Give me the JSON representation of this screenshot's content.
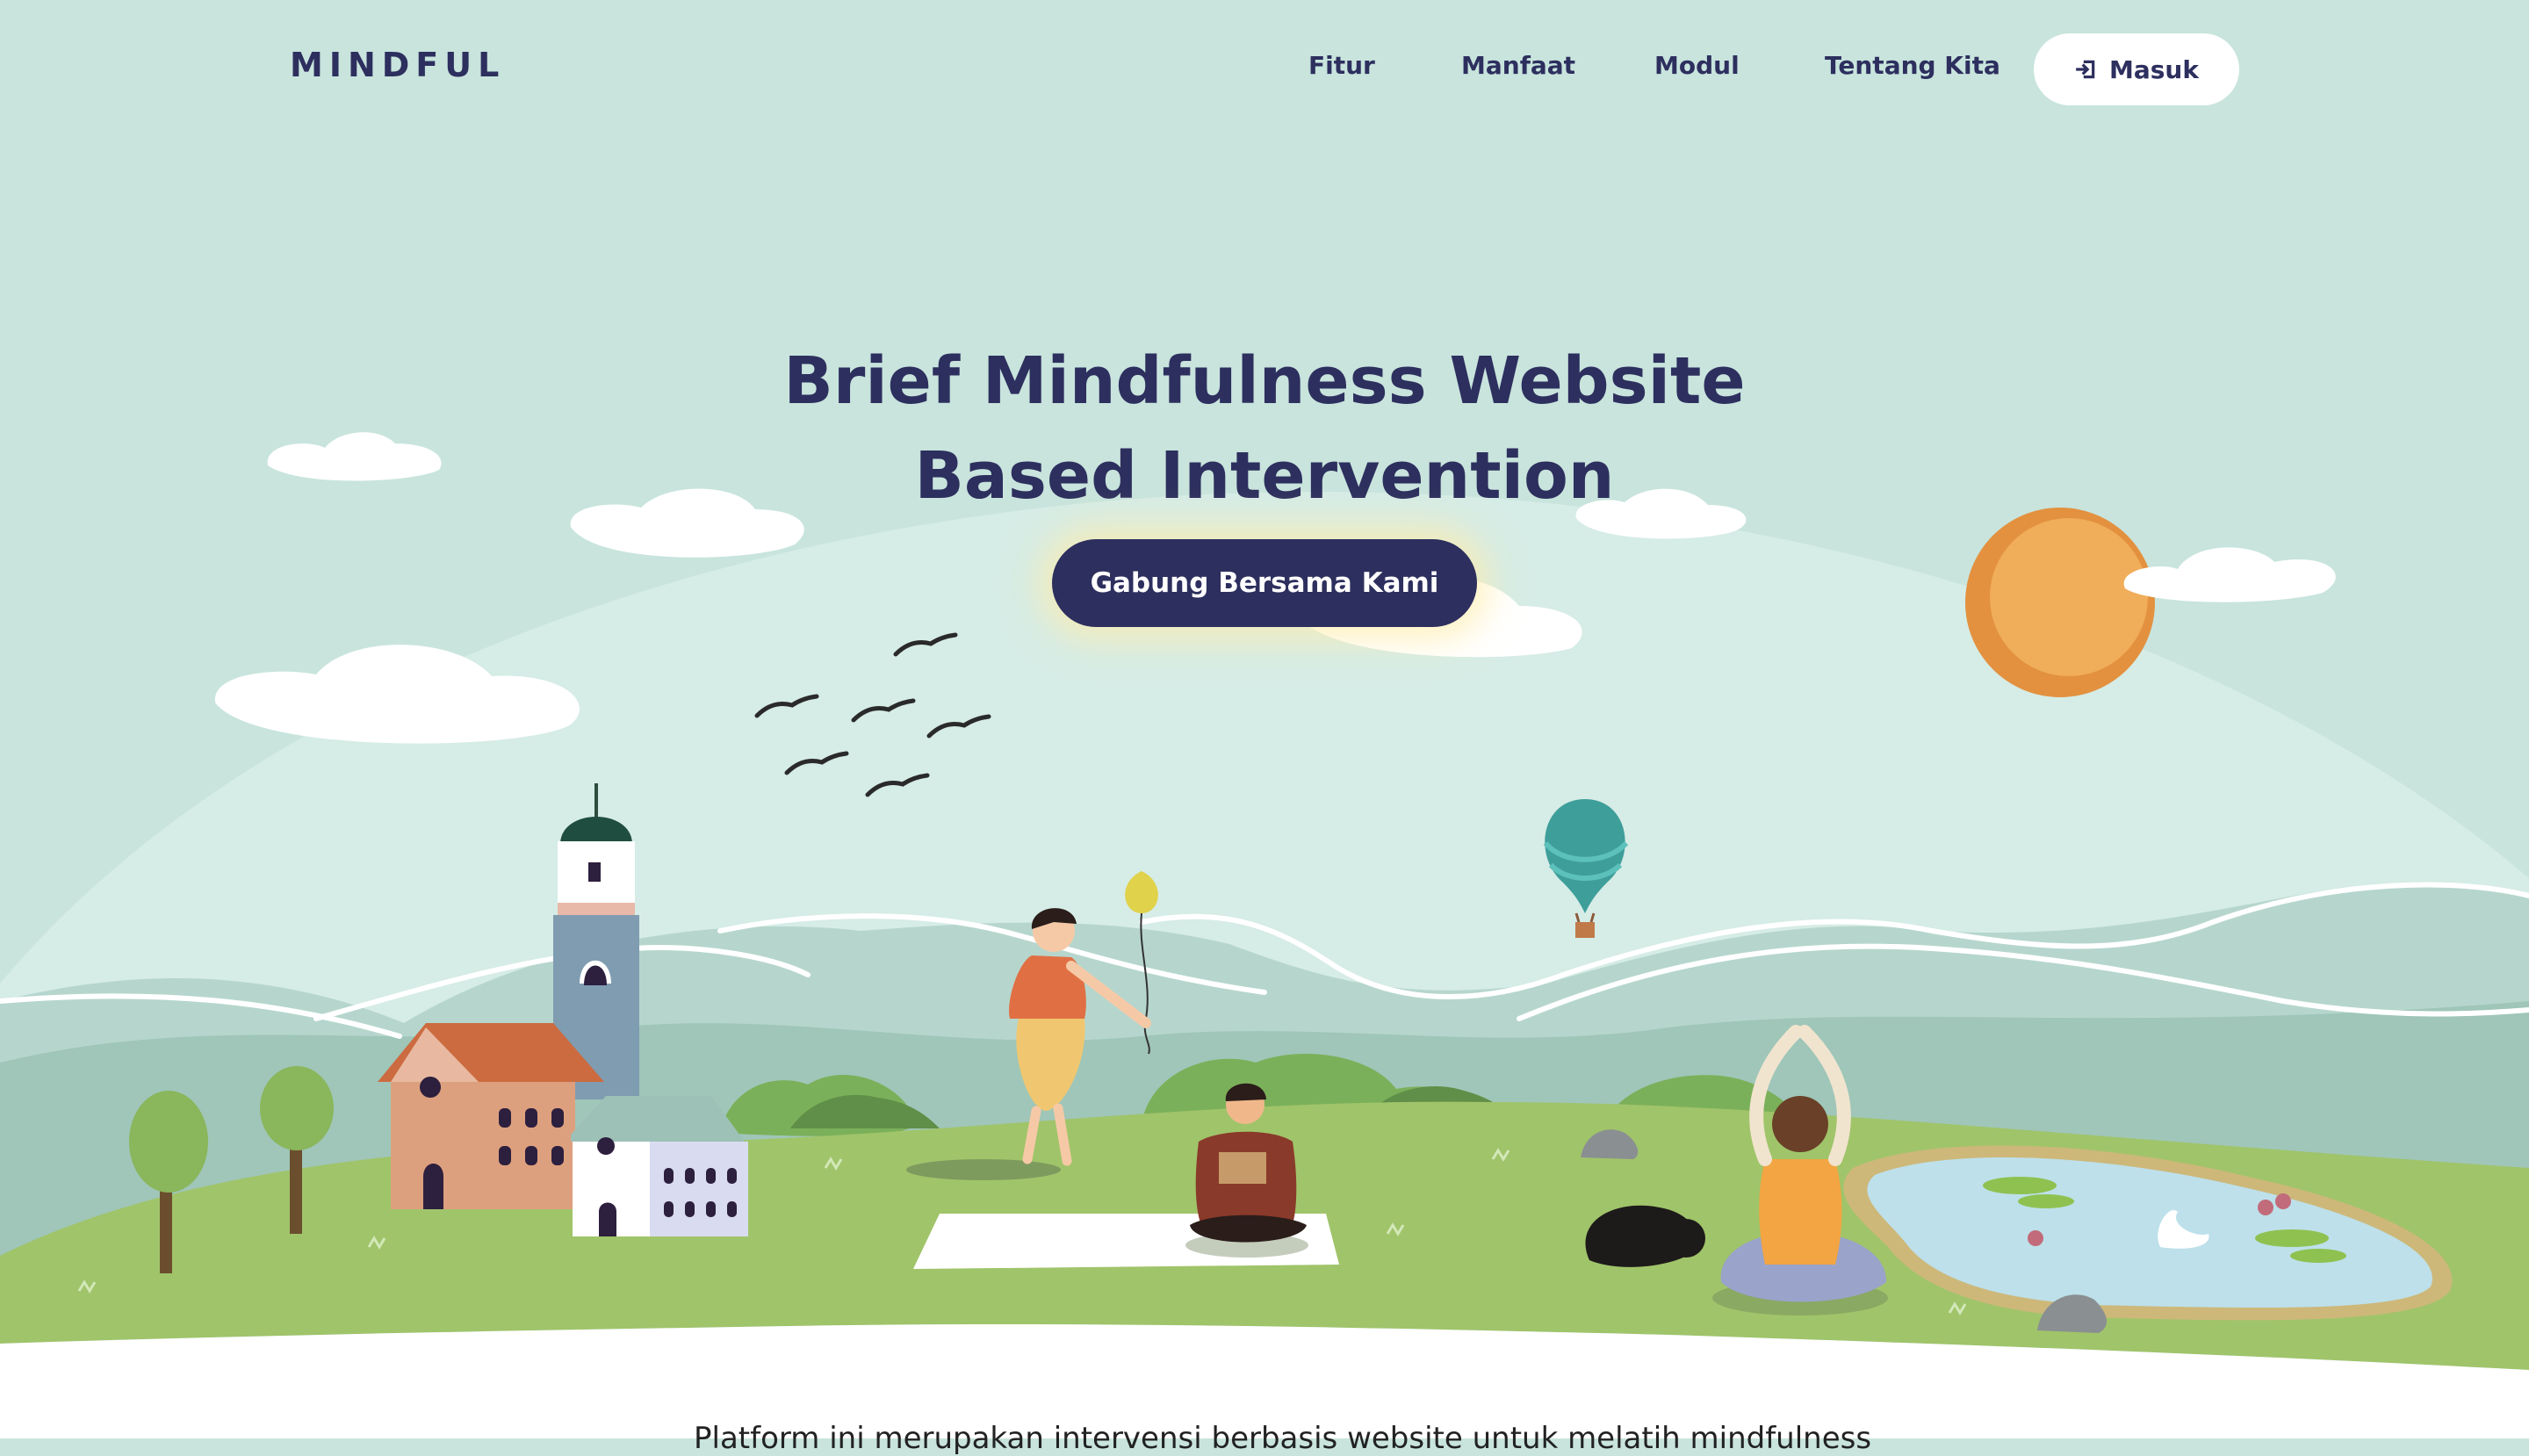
{
  "brand": {
    "logo": "MINDFUL"
  },
  "nav": {
    "links": [
      "Fitur",
      "Manfaat",
      "Modul",
      "Tentang Kita"
    ],
    "login_label": "Masuk"
  },
  "hero": {
    "title_line1": "Brief Mindfulness Website",
    "title_line2": "Based Intervention",
    "cta_label": "Gabung Bersama Kami"
  },
  "below_fold": {
    "intro_text": "Platform ini merupakan intervensi berbasis website untuk melatih mindfulness"
  },
  "colors": {
    "sky": "#c8e4dd",
    "navy": "#2d2f5e",
    "grass": "#a0c46a",
    "sun": "#eda24c",
    "lake": "#bde0ea"
  }
}
